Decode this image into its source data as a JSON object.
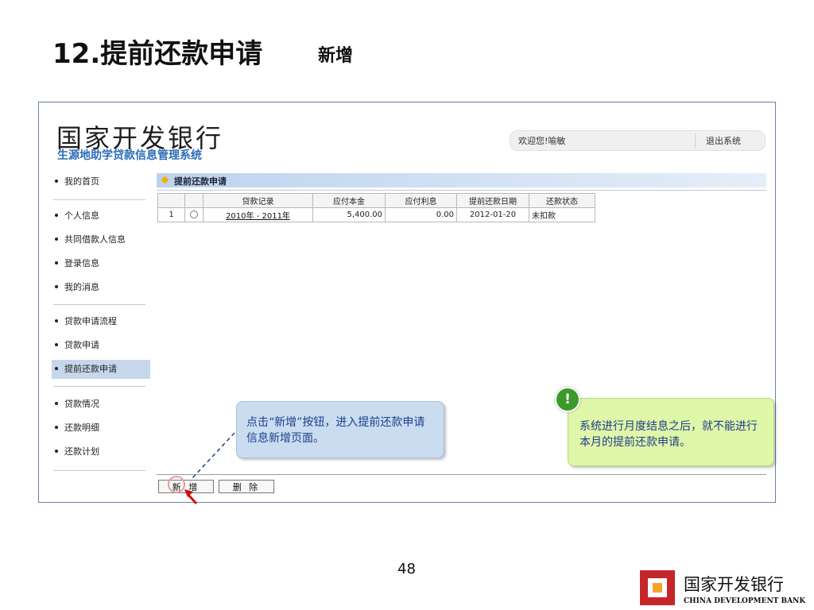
{
  "slide": {
    "title": "12.提前还款申请",
    "subtitle": "新增",
    "page_number": "48"
  },
  "app": {
    "brand_name": "国家开发银行",
    "brand_subtitle": "生源地助学贷款信息管理系统",
    "welcome": "欢迎您!喻敏",
    "logout": "退出系统"
  },
  "sidebar": {
    "items": [
      {
        "label": "我的首页"
      },
      {
        "label": "个人信息"
      },
      {
        "label": "共同借款人信息"
      },
      {
        "label": "登录信息"
      },
      {
        "label": "我的消息"
      },
      {
        "label": "贷款申请流程"
      },
      {
        "label": "贷款申请"
      },
      {
        "label": "提前还款申请"
      },
      {
        "label": "贷款情况"
      },
      {
        "label": "还款明细"
      },
      {
        "label": "还款计划"
      }
    ],
    "active_item": "提前还款申请"
  },
  "panel": {
    "title": "提前还款申请",
    "accent_color": "#f0b000"
  },
  "table": {
    "headers": [
      "",
      "",
      "贷款记录",
      "应付本金",
      "应付利息",
      "提前还款日期",
      "还款状态"
    ],
    "rows": [
      {
        "index": "1",
        "record": "2010年 - 2011年",
        "principal": "5,400.00",
        "interest": "0.00",
        "date": "2012-01-20",
        "status": "未扣款"
      }
    ]
  },
  "buttons": {
    "add": "新 增",
    "delete": "删 除"
  },
  "callouts": {
    "hint": "点击“新增”按钮，进入提前还款申请信息新增页面。",
    "warning_icon": "!",
    "warning": "系统进行月度结息之后，就不能进行本月的提前还款申请。"
  },
  "footer": {
    "bank_cn": "国家开发银行",
    "bank_en": "CHINA DEVELOPMENT BANK"
  },
  "icons": {
    "bullet": "dot-icon",
    "panel_marker": "diamond-icon",
    "pointer": "arrow-cursor-icon",
    "logo": "cdb-logo-icon"
  }
}
